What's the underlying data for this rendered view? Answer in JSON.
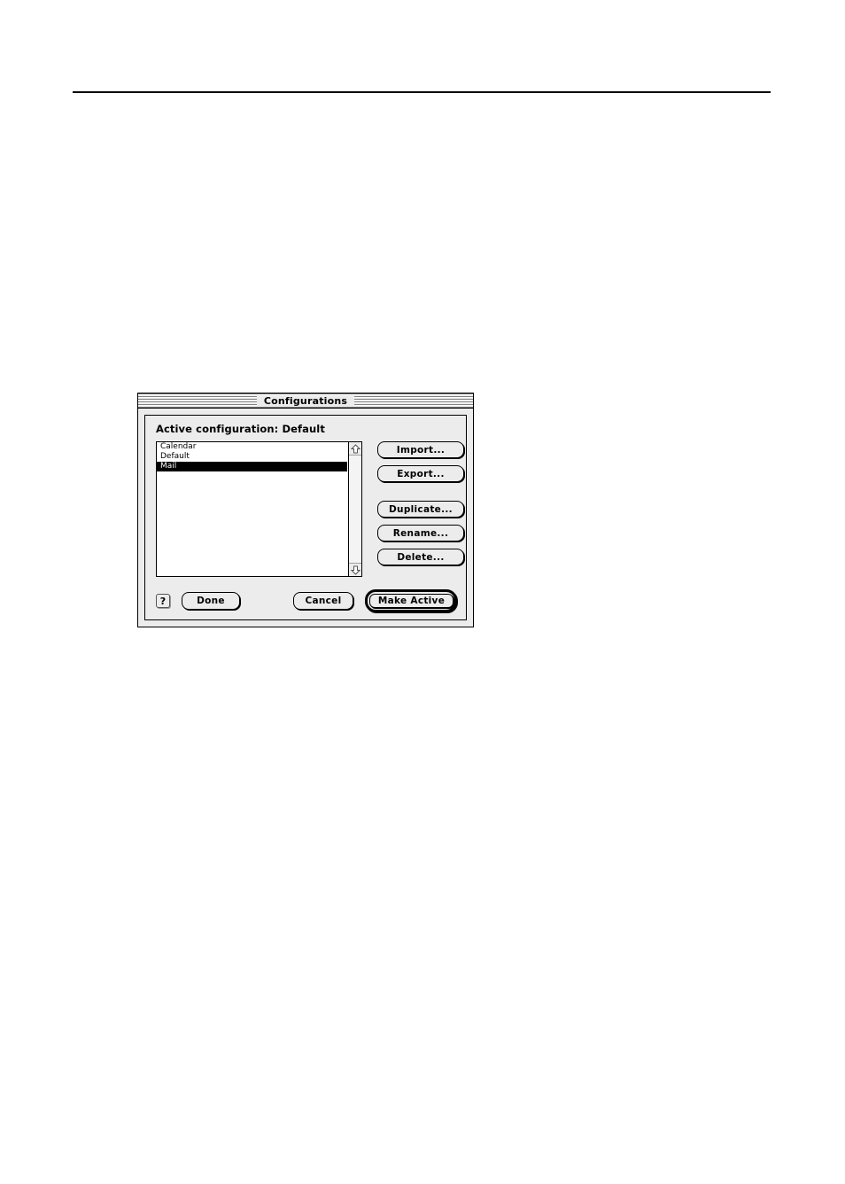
{
  "page": {
    "rule": "horizontal-rule"
  },
  "dialog": {
    "title": "Configurations",
    "active_config_label": "Active configuration: Default",
    "list": {
      "items": [
        {
          "label": "Calendar",
          "selected": false
        },
        {
          "label": "Default",
          "selected": false
        },
        {
          "label": "Mail",
          "selected": true
        }
      ],
      "scroll_up_icon": "arrow-up-icon",
      "scroll_down_icon": "arrow-down-icon"
    },
    "side_buttons": [
      {
        "label": "Import...",
        "gap_before": false
      },
      {
        "label": "Export...",
        "gap_before": false
      },
      {
        "label": "Duplicate...",
        "gap_before": true
      },
      {
        "label": "Rename...",
        "gap_before": false
      },
      {
        "label": "Delete...",
        "gap_before": false
      }
    ],
    "bottom": {
      "help_icon": "question-mark-icon",
      "help_glyph": "?",
      "done_label": "Done",
      "cancel_label": "Cancel",
      "make_active_label": "Make Active"
    },
    "colors": {
      "window_background": "#ececec",
      "list_background": "#ffffff",
      "selection_background": "#000000",
      "selection_text": "#ffffff",
      "border": "#000000",
      "page_background": "#ffffff"
    }
  }
}
